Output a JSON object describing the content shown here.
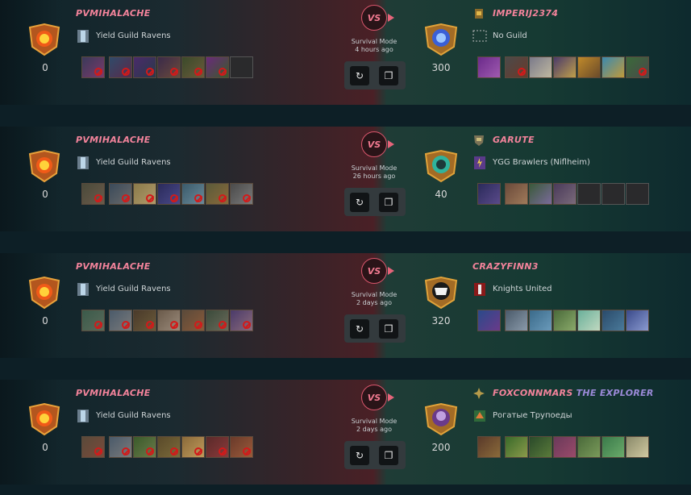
{
  "battles": [
    {
      "left": {
        "name": "PVMIHALACHE",
        "guild": "Yield Guild Ravens",
        "score": "0"
      },
      "vs": "VS",
      "mode": "Survival Mode",
      "time": "4 hours ago",
      "right": {
        "name": "IMPERIJ2374",
        "title": "",
        "guild": "No Guild",
        "score": "300"
      }
    },
    {
      "left": {
        "name": "PVMIHALACHE",
        "guild": "Yield Guild Ravens",
        "score": "0"
      },
      "vs": "VS",
      "mode": "Survival Mode",
      "time": "26 hours ago",
      "right": {
        "name": "GARUTE",
        "title": "",
        "guild": "YGG Brawlers (Niflheim)",
        "score": "40"
      }
    },
    {
      "left": {
        "name": "PVMIHALACHE",
        "guild": "Yield Guild Ravens",
        "score": "0"
      },
      "vs": "VS",
      "mode": "Survival Mode",
      "time": "2 days ago",
      "right": {
        "name": "CRAZYFINN3",
        "title": "",
        "guild": "Knights United",
        "score": "320"
      }
    },
    {
      "left": {
        "name": "PVMIHALACHE",
        "guild": "Yield Guild Ravens",
        "score": "0"
      },
      "vs": "VS",
      "mode": "Survival Mode",
      "time": "2 days ago",
      "right": {
        "name": "FOXCONNMARS",
        "title": "THE EXPLORER",
        "guild": "Рогатые Трупоеды",
        "score": "200"
      }
    }
  ],
  "icons": {
    "replay": "replay-icon",
    "copy": "copy-icon"
  },
  "colors": {
    "name": "#f3839b",
    "title": "#9b8ad8",
    "ban": "#d21a1a",
    "vs": "#f07a90"
  }
}
